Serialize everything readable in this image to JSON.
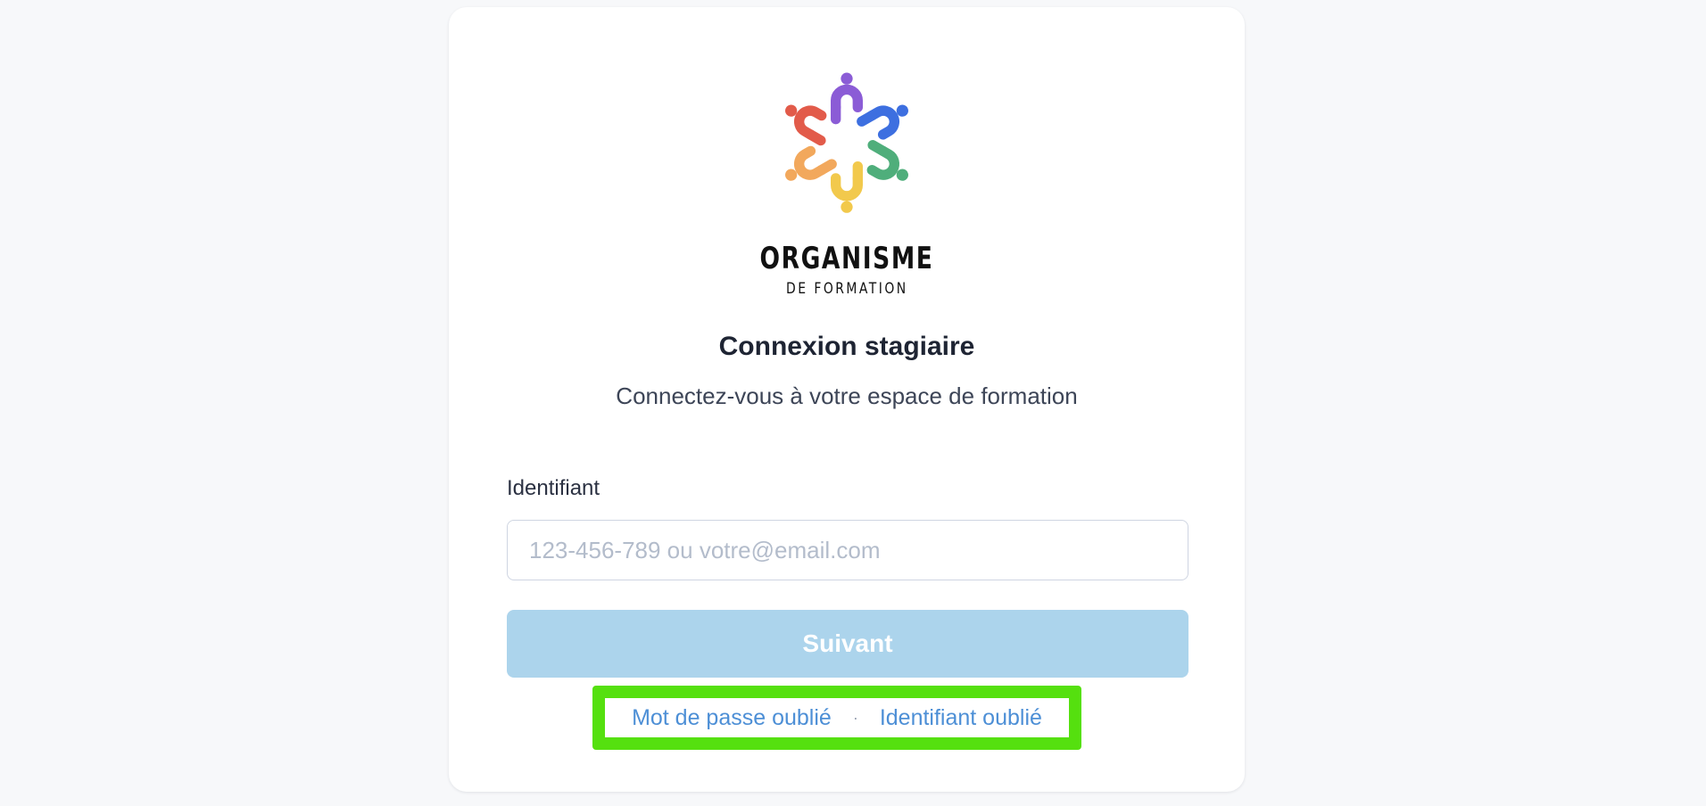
{
  "brand": {
    "name": "ORGANISME",
    "subtitle": "DE FORMATION",
    "logo_colors": [
      "#e25b4a",
      "#8b5cd6",
      "#3d6fe0",
      "#4fae7b",
      "#f2c94c",
      "#f2a85c"
    ]
  },
  "login": {
    "title": "Connexion stagiaire",
    "subtitle": "Connectez-vous à votre espace de formation",
    "identifier_label": "Identifiant",
    "identifier_placeholder": "123-456-789 ou votre@email.com",
    "identifier_value": "",
    "next_button_label": "Suivant"
  },
  "links": {
    "forgot_password": "Mot de passe oublié",
    "separator": "·",
    "forgot_identifier": "Identifiant oublié"
  },
  "colors": {
    "button_disabled": "#acd4ec",
    "link": "#4d8fd6",
    "highlight": "#55e00f"
  }
}
